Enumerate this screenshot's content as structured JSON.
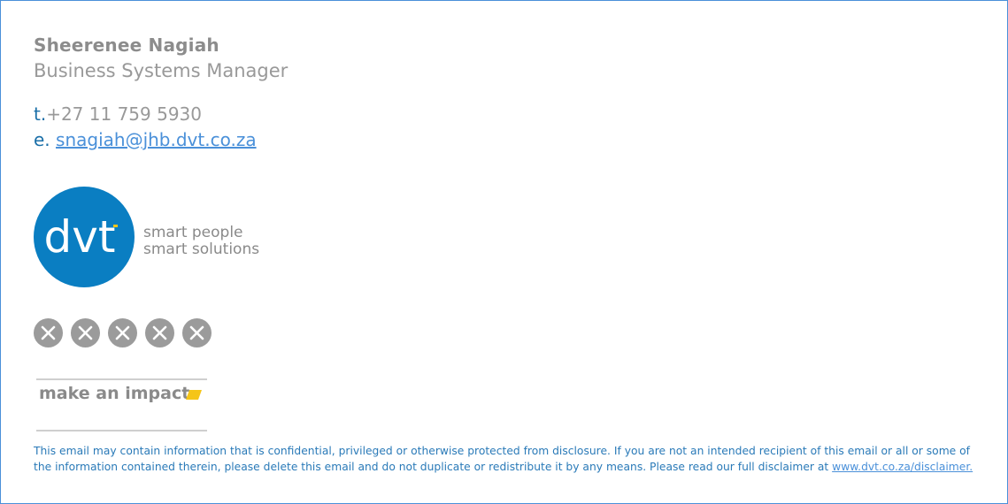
{
  "signature": {
    "name": "Sheerenee Nagiah",
    "job_title": "Business Systems Manager",
    "phone_prefix": "t.",
    "phone": "+27 11 759 5930",
    "email_prefix": "e.",
    "email": "snagiah@jhb.dvt.co.za"
  },
  "logo": {
    "brand": "dvt",
    "tagline_line1": "smart people",
    "tagline_line2": "smart solutions",
    "brand_color": "#0a7ec2",
    "accent_color": "#f5c518"
  },
  "social_icons": [
    {
      "icon": "broken-image-icon"
    },
    {
      "icon": "broken-image-icon"
    },
    {
      "icon": "broken-image-icon"
    },
    {
      "icon": "broken-image-icon"
    },
    {
      "icon": "broken-image-icon"
    }
  ],
  "banner": {
    "text": "make an impact"
  },
  "disclaimer": {
    "text": "This email may contain information that is confidential, privileged or otherwise protected from disclosure. If you are not an intended recipient of this email or all or some of the information contained therein, please delete this email and do not duplicate or redistribute it by any means.  Please read our full disclaimer at ",
    "link_text": "www.dvt.co.za/disclaimer."
  }
}
